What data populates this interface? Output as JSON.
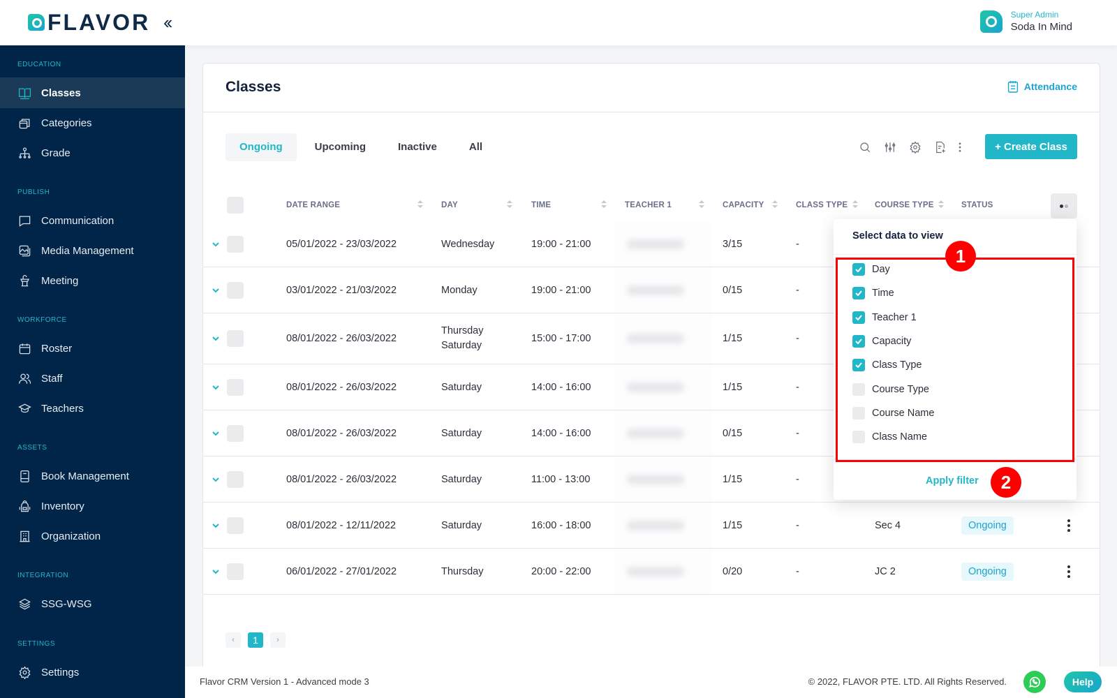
{
  "brand": {
    "logo_text": "FLAVOR",
    "collapse_icon": "chevrons-left-icon"
  },
  "user": {
    "role": "Super Admin",
    "name": "Soda In Mind"
  },
  "sidebar": {
    "sections": [
      {
        "title": "EDUCATION",
        "items": [
          {
            "label": "Classes",
            "icon": "book-open-icon",
            "active": true
          },
          {
            "label": "Categories",
            "icon": "layers-box-icon"
          },
          {
            "label": "Grade",
            "icon": "hierarchy-icon"
          }
        ]
      },
      {
        "title": "PUBLISH",
        "items": [
          {
            "label": "Communication",
            "icon": "message-icon"
          },
          {
            "label": "Media Management",
            "icon": "gallery-icon"
          },
          {
            "label": "Meeting",
            "icon": "podium-icon"
          }
        ]
      },
      {
        "title": "WORKFORCE",
        "items": [
          {
            "label": "Roster",
            "icon": "calendar-icon"
          },
          {
            "label": "Staff",
            "icon": "users-icon"
          },
          {
            "label": "Teachers",
            "icon": "graduation-cap-icon"
          }
        ]
      },
      {
        "title": "ASSETS",
        "items": [
          {
            "label": "Book Management",
            "icon": "book-icon"
          },
          {
            "label": "Inventory",
            "icon": "backpack-icon"
          },
          {
            "label": "Organization",
            "icon": "building-icon"
          }
        ]
      },
      {
        "title": "INTEGRATION",
        "items": [
          {
            "label": "SSG-WSG",
            "icon": "stack-icon"
          }
        ]
      },
      {
        "title": "SETTINGS",
        "items": [
          {
            "label": "Settings",
            "icon": "gear-icon"
          }
        ]
      }
    ]
  },
  "page": {
    "title": "Classes",
    "attendance_label": "Attendance",
    "tabs": [
      {
        "label": "Ongoing",
        "active": true
      },
      {
        "label": "Upcoming"
      },
      {
        "label": "Inactive"
      },
      {
        "label": "All"
      }
    ],
    "toolbar_icons": [
      "search-icon",
      "sliders-icon",
      "gear-icon",
      "export-file-icon",
      "more-vertical-icon"
    ],
    "create_button": "+ Create Class"
  },
  "table": {
    "columns": [
      "DATE RANGE",
      "DAY",
      "TIME",
      "TEACHER 1",
      "CAPACITY",
      "CLASS TYPE",
      "COURSE TYPE",
      "STATUS"
    ],
    "rows": [
      {
        "date_range": "05/01/2022 - 23/03/2022",
        "day": [
          "Wednesday"
        ],
        "time": "19:00 - 21:00",
        "teacher": "(blurred)",
        "capacity": "3/15",
        "class_type": "-",
        "course_type": "",
        "status": ""
      },
      {
        "date_range": "03/01/2022 - 21/03/2022",
        "day": [
          "Monday"
        ],
        "time": "19:00 - 21:00",
        "teacher": "(blurred)",
        "capacity": "0/15",
        "class_type": "-",
        "course_type": "",
        "status": ""
      },
      {
        "date_range": "08/01/2022 - 26/03/2022",
        "day": [
          "Thursday",
          "Saturday"
        ],
        "time": "15:00 - 17:00",
        "teacher": "(blurred)",
        "capacity": "1/15",
        "class_type": "-",
        "course_type": "",
        "status": ""
      },
      {
        "date_range": "08/01/2022 - 26/03/2022",
        "day": [
          "Saturday"
        ],
        "time": "14:00 - 16:00",
        "teacher": "(blurred)",
        "capacity": "1/15",
        "class_type": "-",
        "course_type": "",
        "status": ""
      },
      {
        "date_range": "08/01/2022 - 26/03/2022",
        "day": [
          "Saturday"
        ],
        "time": "14:00 - 16:00",
        "teacher": "(blurred)",
        "capacity": "0/15",
        "class_type": "-",
        "course_type": "",
        "status": ""
      },
      {
        "date_range": "08/01/2022 - 26/03/2022",
        "day": [
          "Saturday"
        ],
        "time": "11:00 - 13:00",
        "teacher": "(blurred)",
        "capacity": "1/15",
        "class_type": "-",
        "course_type": "",
        "status": ""
      },
      {
        "date_range": "08/01/2022 - 12/11/2022",
        "day": [
          "Saturday"
        ],
        "time": "16:00 - 18:00",
        "teacher": "(blurred)",
        "capacity": "1/15",
        "class_type": "-",
        "course_type": "Sec 4",
        "status": "Ongoing"
      },
      {
        "date_range": "06/01/2022 - 27/01/2022",
        "day": [
          "Thursday"
        ],
        "time": "20:00 - 22:00",
        "teacher": "(blurred)",
        "capacity": "0/20",
        "class_type": "-",
        "course_type": "JC 2",
        "status": "Ongoing"
      }
    ]
  },
  "pagination": {
    "prev": "‹",
    "current": "1",
    "next": "›"
  },
  "column_picker": {
    "title": "Select data to view",
    "options": [
      {
        "label": "Day",
        "checked": true
      },
      {
        "label": "Time",
        "checked": true
      },
      {
        "label": "Teacher 1",
        "checked": true
      },
      {
        "label": "Capacity",
        "checked": true
      },
      {
        "label": "Class Type",
        "checked": true
      },
      {
        "label": "Course Type",
        "checked": false
      },
      {
        "label": "Course Name",
        "checked": false
      },
      {
        "label": "Class Name",
        "checked": false
      }
    ],
    "apply_label": "Apply filter"
  },
  "annotations": [
    "1",
    "2"
  ],
  "footer": {
    "version": "Flavor CRM Version 1 - Advanced mode 3",
    "copyright": "© 2022, FLAVOR PTE. LTD. All Rights Reserved.",
    "help_label": "Help"
  },
  "colors": {
    "accent": "#21b7c8",
    "sidebar_bg": "#012549",
    "annotation": "#ff0000"
  }
}
